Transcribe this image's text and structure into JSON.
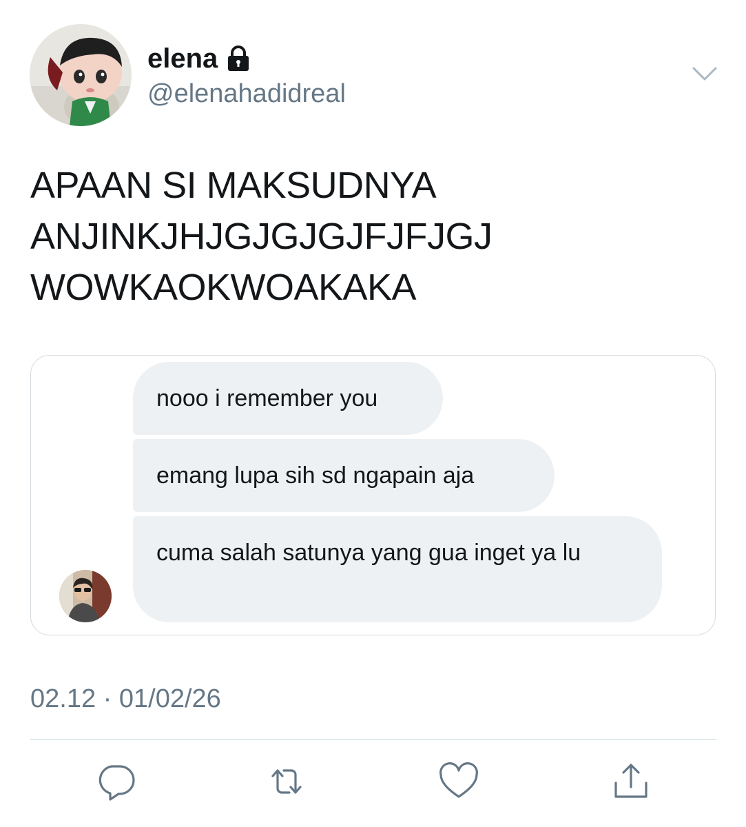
{
  "header": {
    "display_name": "elena",
    "handle": "@elenahadidreal"
  },
  "tweet": {
    "lines": [
      "APAAN SI MAKSUDNYA",
      "ANJINKJHJGJGJGJFJFJGJ",
      "WOWKAOKWOAKAKA"
    ]
  },
  "media": {
    "messages": [
      "nooo i remember you",
      "emang lupa sih sd ngapain aja",
      "cuma salah satunya yang gua inget ya lu"
    ]
  },
  "meta": {
    "timestamp": "02.12 · 01/02/26"
  },
  "icons": {
    "lock": "lock-icon",
    "caret": "chevron-down-icon",
    "reply": "reply-icon",
    "retweet": "retweet-icon",
    "like": "heart-icon",
    "share": "share-icon"
  },
  "colors": {
    "text": "#14171a",
    "secondary": "#657786",
    "bubble": "#eef1f3",
    "border": "#d4dbe0",
    "icon": "#657786"
  }
}
